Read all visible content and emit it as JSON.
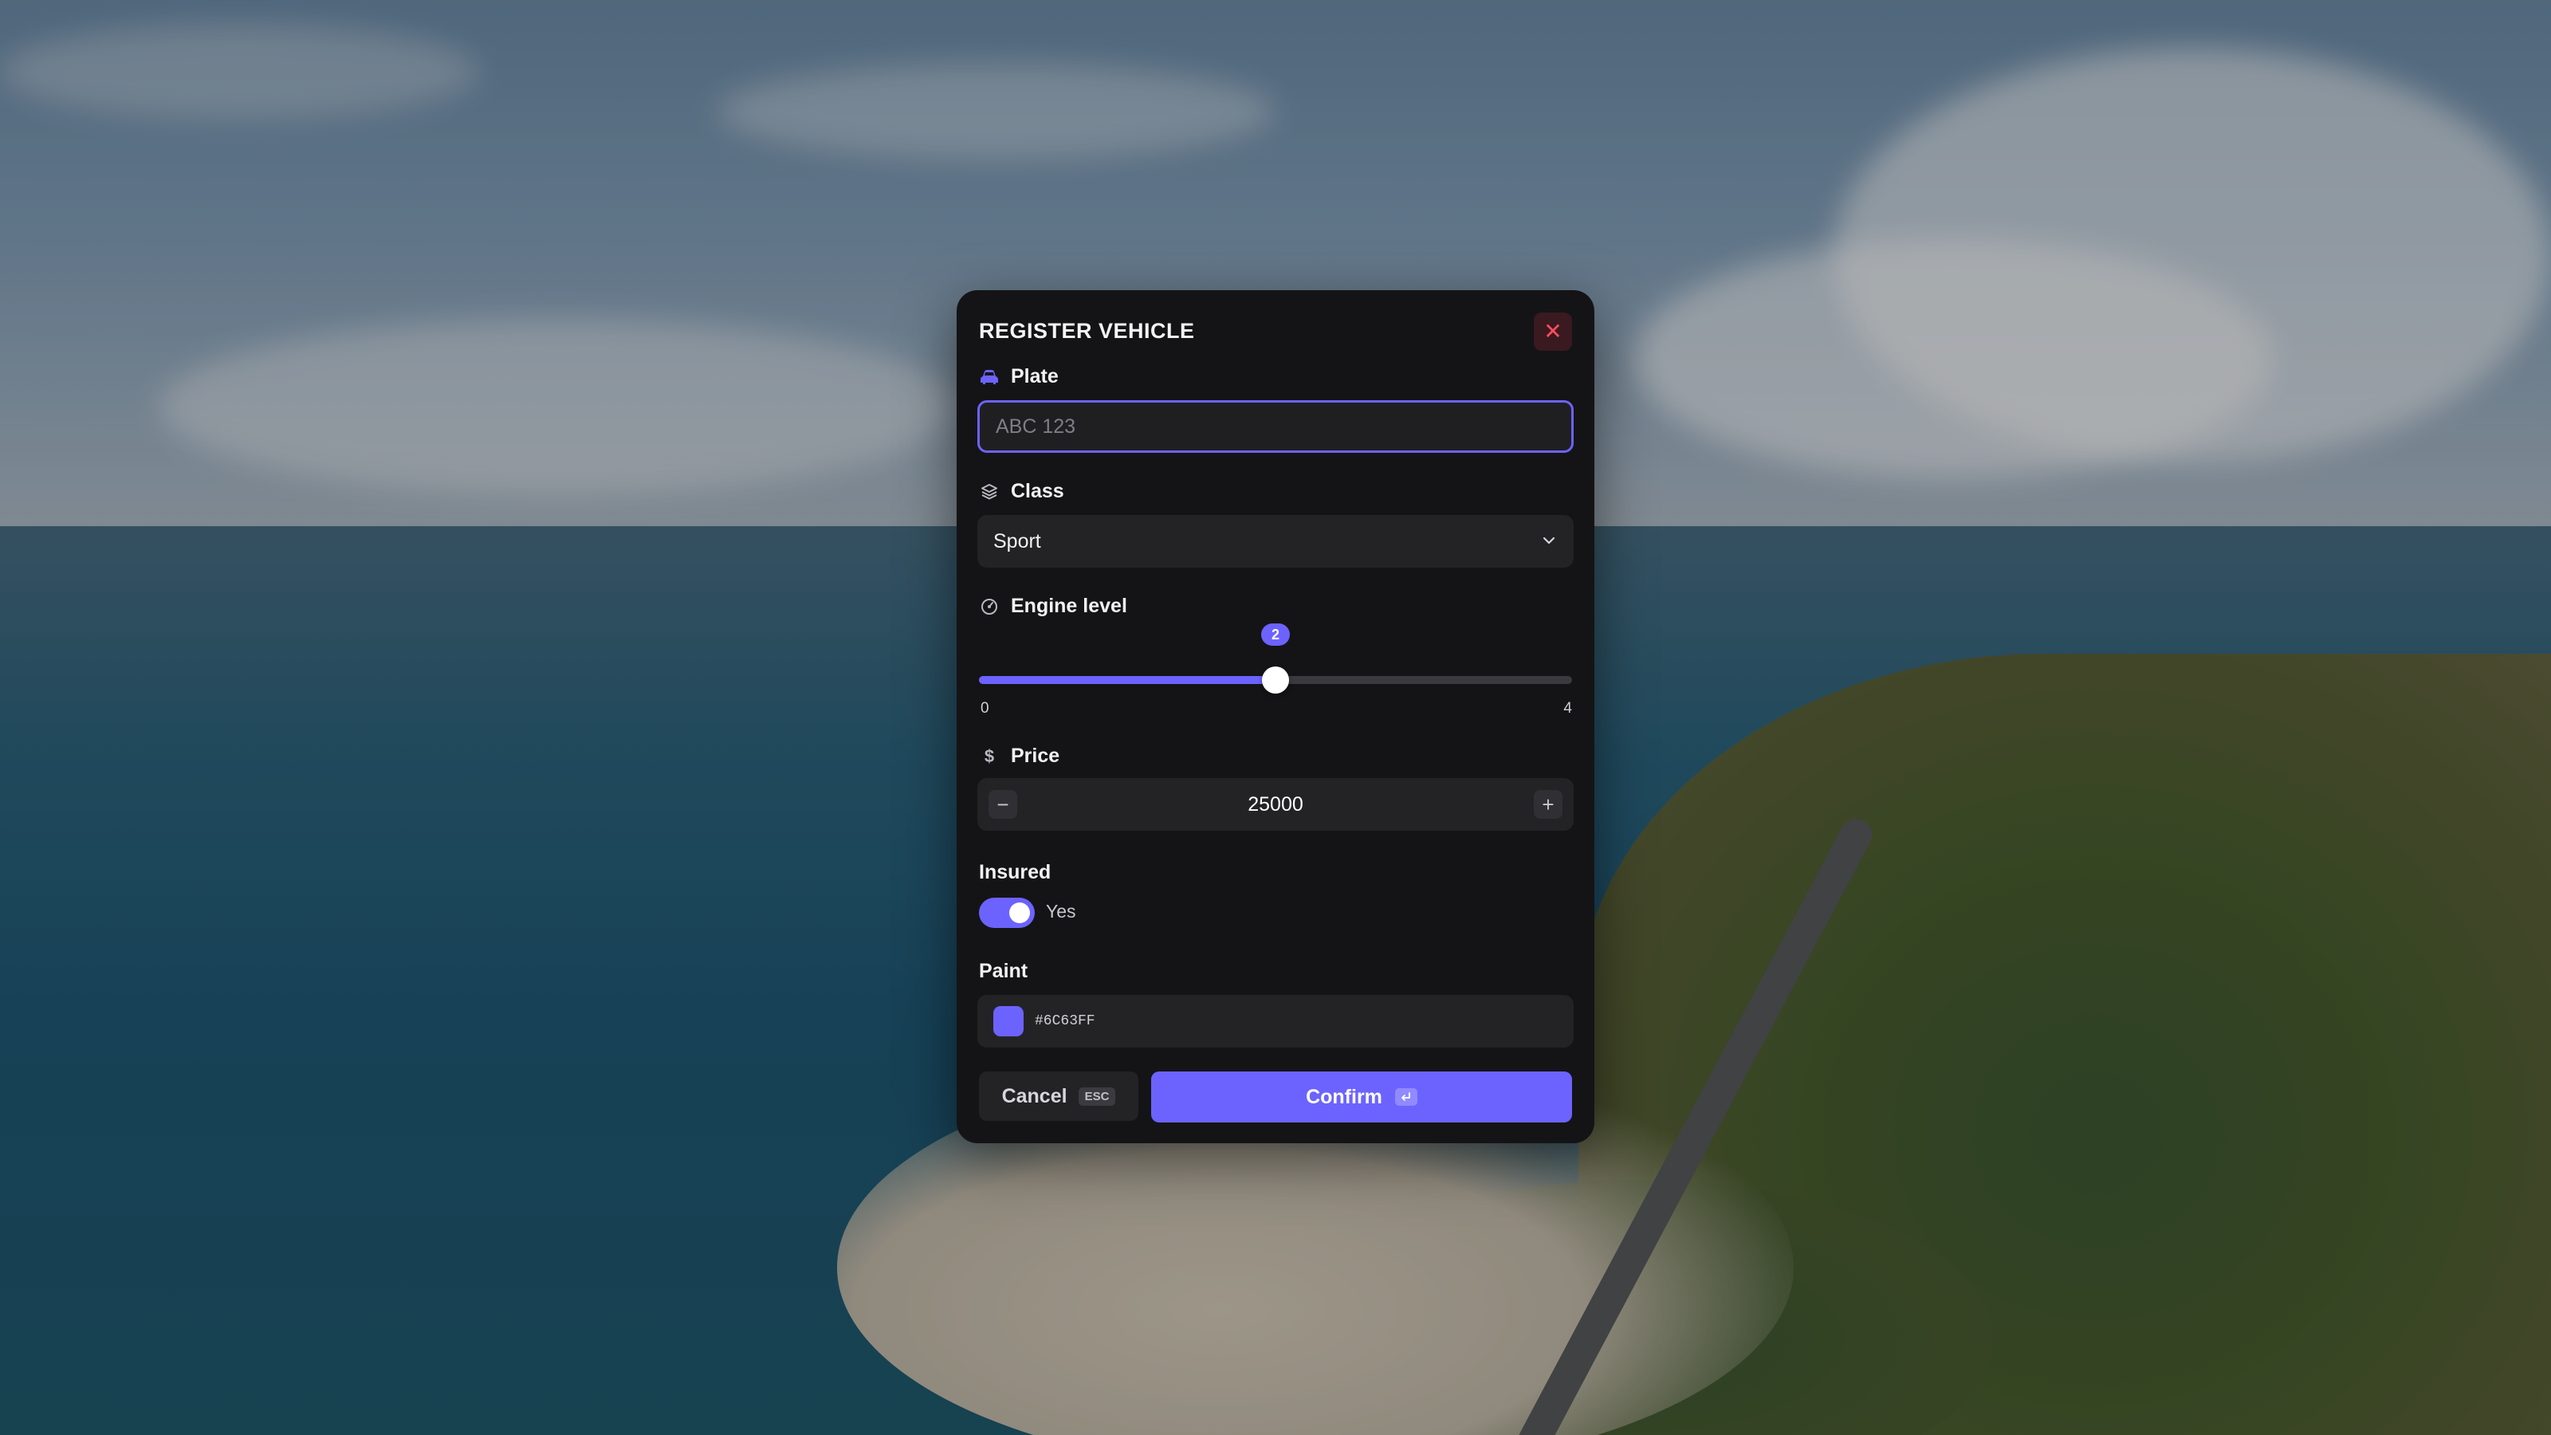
{
  "dialog": {
    "title": "REGISTER VEHICLE",
    "close_icon": "close-icon"
  },
  "plate": {
    "label": "Plate",
    "icon": "car-icon",
    "value": "",
    "placeholder": "ABC 123"
  },
  "class": {
    "label": "Class",
    "icon": "layers-icon",
    "selected": "Sport"
  },
  "engine": {
    "label": "Engine level",
    "icon": "gauge-icon",
    "value": "2",
    "min": "0",
    "max": "4"
  },
  "price": {
    "label": "Price",
    "icon": "dollar-icon",
    "value": "25000",
    "decrement": "−",
    "increment": "+"
  },
  "insured": {
    "label": "Insured",
    "on": true,
    "state_text": "Yes"
  },
  "paint": {
    "label": "Paint",
    "hex": "#6C63FF"
  },
  "actions": {
    "cancel_label": "Cancel",
    "cancel_key": "ESC",
    "confirm_label": "Confirm"
  },
  "colors": {
    "accent": "#6c63ff",
    "close": "#ff4d5e",
    "dialog_bg": "#141416"
  }
}
